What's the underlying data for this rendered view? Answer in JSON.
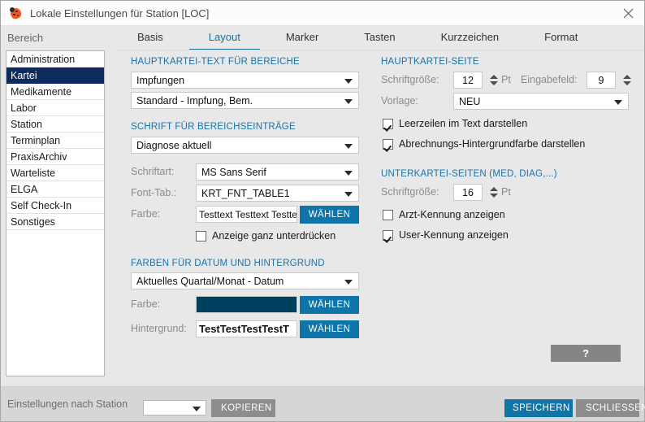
{
  "window": {
    "title": "Lokale Einstellungen für Station [LOC]",
    "app_icon": "ladybug-icon",
    "close_icon": "close-icon"
  },
  "sidebar": {
    "label": "Bereich",
    "items": [
      {
        "label": "Administration",
        "selected": false
      },
      {
        "label": "Kartei",
        "selected": true
      },
      {
        "label": "Medikamente",
        "selected": false
      },
      {
        "label": "Labor",
        "selected": false
      },
      {
        "label": "Station",
        "selected": false
      },
      {
        "label": "Terminplan",
        "selected": false
      },
      {
        "label": "PraxisArchiv",
        "selected": false
      },
      {
        "label": "Warteliste",
        "selected": false
      },
      {
        "label": "ELGA",
        "selected": false
      },
      {
        "label": "Self Check-In",
        "selected": false
      },
      {
        "label": "Sonstiges",
        "selected": false
      }
    ],
    "selection_color": "#0d2b5e"
  },
  "tabs": [
    {
      "label": "Basis",
      "active": false
    },
    {
      "label": "Layout",
      "active": true
    },
    {
      "label": "Marker",
      "active": false
    },
    {
      "label": "Tasten",
      "active": false
    },
    {
      "label": "Kurzzeichen",
      "active": false
    },
    {
      "label": "Format",
      "active": false
    }
  ],
  "accent_color": "#1a72a8",
  "left": {
    "group1_title": "HAUPTKARTEI-TEXT FÜR BEREICHE",
    "combo1_value": "Impfungen",
    "combo2_value": "Standard - Impfung, Bem.",
    "group2_title": "SCHRIFT FÜR BEREICHSEINTRÄGE",
    "combo3_value": "Diagnose aktuell",
    "schriftart_label": "Schriftart:",
    "schriftart_value": "MS Sans Serif",
    "fonttab_label": "Font-Tab.:",
    "fonttab_value": "KRT_FNT_TABLE1",
    "farbe_label": "Farbe:",
    "farbe_preview": "Testtext Testtext Testtext",
    "waehlen_label": "WÄHLEN",
    "suppress_checkbox_label": "Anzeige ganz unterdrücken",
    "suppress_checked": false,
    "group3_title": "FARBEN FÜR DATUM UND HINTERGRUND",
    "combo4_value": "Aktuelles Quartal/Monat - Datum",
    "farbe2_label": "Farbe:",
    "farbe2_swatch_color": "#00405f",
    "farbe2_waehlen_label": "WÄHLEN",
    "hintergrund_label": "Hintergrund:",
    "hintergrund_preview": "TestTestTestTestT",
    "hintergrund_waehlen_label": "WÄHLEN"
  },
  "right": {
    "group1_title": "HAUPTKARTEI-SEITE",
    "schriftgroesse_label": "Schriftgröße:",
    "schriftgroesse_value": "12",
    "pt_unit": "Pt",
    "eingabefeld_label": "Eingabefeld:",
    "eingabefeld_value": "9",
    "vorlage_label": "Vorlage:",
    "vorlage_value": "NEU",
    "cb_leerzeilen_label": "Leerzeilen im Text darstellen",
    "cb_leerzeilen_checked": true,
    "cb_abrechnung_label": "Abrechnungs-Hintergrundfarbe darstellen",
    "cb_abrechnung_checked": true,
    "group2_title": "UNTERKARTEI-SEITEN (MED, DIAG,...)",
    "schriftgroesse2_label": "Schriftgröße:",
    "schriftgroesse2_value": "16",
    "pt_unit2": "Pt",
    "cb_arzt_label": "Arzt-Kennung anzeigen",
    "cb_arzt_checked": false,
    "cb_user_label": "User-Kennung anzeigen",
    "cb_user_checked": true,
    "help_label": "?"
  },
  "footer": {
    "label": "Einstellungen nach Station",
    "combo_value": "",
    "kopieren_label": "KOPIEREN",
    "speichern_label": "SPEICHERN",
    "schliessen_label": "SCHLIESSEN"
  }
}
